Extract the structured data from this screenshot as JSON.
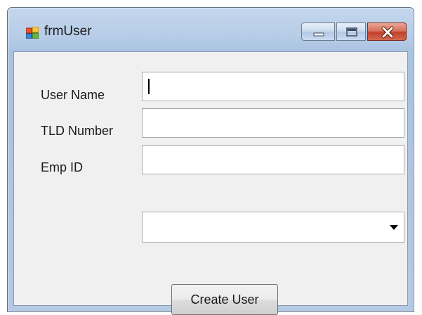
{
  "window": {
    "title": "frmUser",
    "icon": "form-icon",
    "controls": [
      "minimize-icon",
      "maximize-icon",
      "close-icon"
    ]
  },
  "form": {
    "user_name_label": "User Name",
    "user_name_value": "",
    "tld_number_label": "TLD Number",
    "tld_number_value": "",
    "emp_id_label": "Emp ID",
    "emp_id_value": "",
    "dropdown_value": "",
    "create_button": "Create User"
  },
  "colors": {
    "close_button": "#c2412a",
    "client_background": "#f0f0f0",
    "frame": "#b7cde7"
  }
}
